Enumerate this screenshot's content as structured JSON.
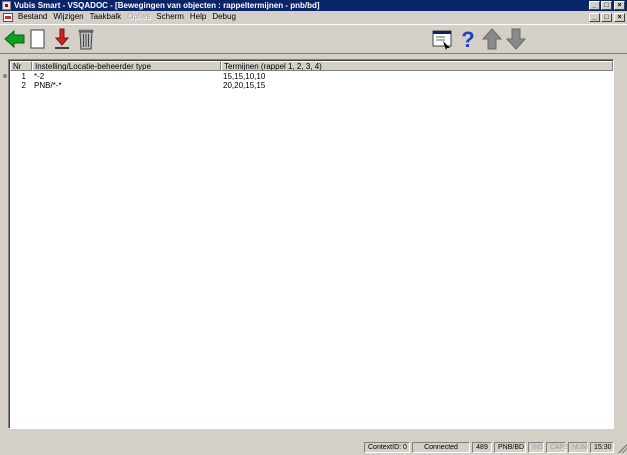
{
  "window": {
    "title": "Vubis Smart - VSQADOC - [Bewegingen van objecten : rappeltermijnen - pnb/bd]",
    "buttons": [
      "minimize",
      "maximize",
      "close"
    ]
  },
  "menu": {
    "items": [
      {
        "label": "Bestand",
        "enabled": true
      },
      {
        "label": "Wijzigen",
        "enabled": true
      },
      {
        "label": "Taakbalk",
        "enabled": true
      },
      {
        "label": "Opties",
        "enabled": false
      },
      {
        "label": "Scherm",
        "enabled": true
      },
      {
        "label": "Help",
        "enabled": true
      },
      {
        "label": "Debug",
        "enabled": true
      }
    ]
  },
  "toolbar": {
    "left": [
      "back-arrow-icon",
      "new-document-icon",
      "import-down-arrow-icon",
      "delete-trash-icon"
    ],
    "right": [
      "window-select-icon",
      "help-question-icon",
      "up-arrow-icon",
      "down-arrow-icon"
    ]
  },
  "grid": {
    "columns": [
      "Nr",
      "Instelling/Locatie-beheerder type",
      "Termijnen (rappel 1, 2, 3, 4)"
    ],
    "rows": [
      {
        "nr": "1",
        "inst": "*-2",
        "term": "15,15,10,10"
      },
      {
        "nr": "2",
        "inst": "PNB/*-*",
        "term": "20,20,15,15"
      }
    ]
  },
  "statusbar": {
    "context": "ContextID: 0",
    "connection": "Connected",
    "count": "489",
    "location": "PNB/BD",
    "ins": "INS",
    "caps": "CAPS",
    "num": "NUM",
    "time": "15:30"
  },
  "colors": {
    "titlebar": "#0a246a",
    "face": "#d4d0c8",
    "back_arrow": "#10a020",
    "import_arrow": "#d02020",
    "nav_arrows": "#8a8a8a",
    "help": "#2040c0"
  }
}
